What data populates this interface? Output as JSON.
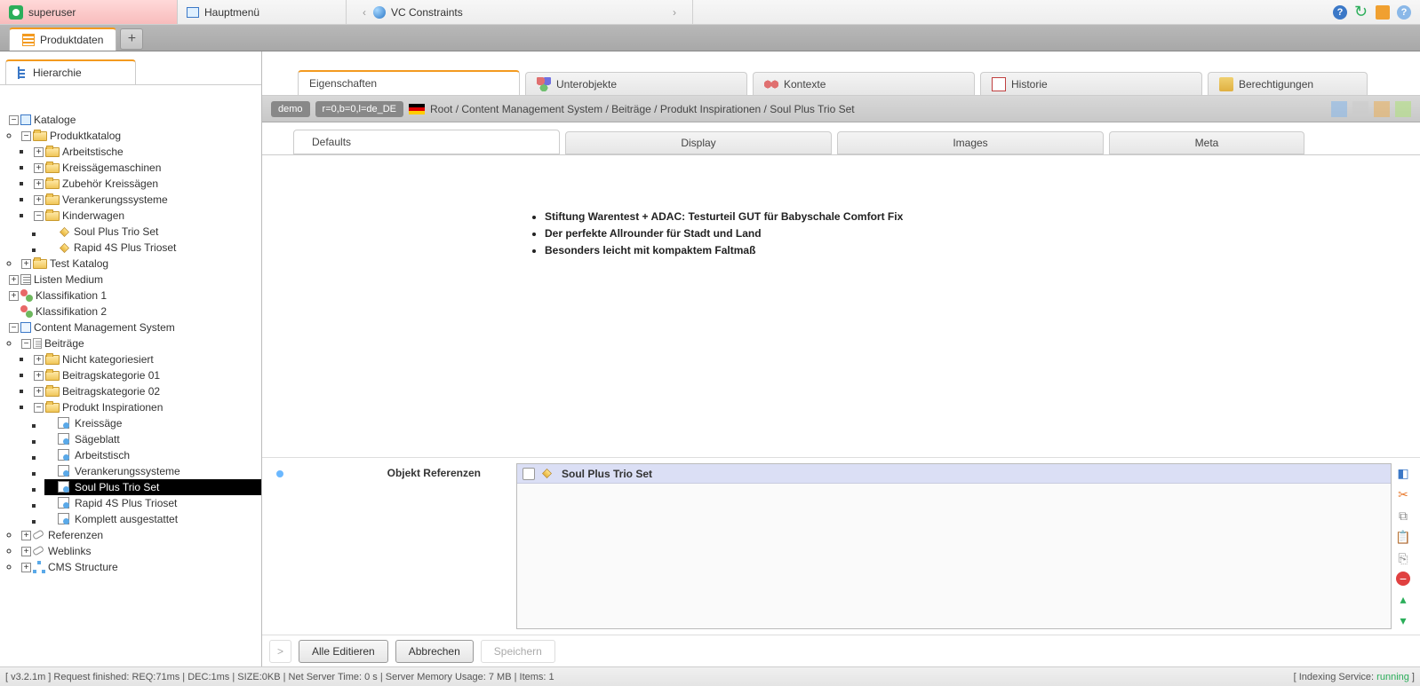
{
  "topbar": {
    "user": "superuser",
    "mainmenu": "Hauptmenü",
    "vc": "VC Constraints"
  },
  "app_tab": "Produktdaten",
  "sidebar_tab": "Hierarchie",
  "tree": {
    "kataloge": "Kataloge",
    "produktkatalog": "Produktkatalog",
    "arbeitstische": "Arbeitstische",
    "kreissaegemaschinen": "Kreissägemaschinen",
    "zubehoer": "Zubehör Kreissägen",
    "verankerung": "Verankerungssysteme",
    "kinderwagen": "Kinderwagen",
    "soul": "Soul Plus Trio Set",
    "rapid": "Rapid 4S Plus Trioset",
    "testkatalog": "Test Katalog",
    "listen": "Listen Medium",
    "klass1": "Klassifikation 1",
    "klass2": "Klassifikation 2",
    "cms": "Content Management System",
    "beitraege": "Beiträge",
    "nichtkat": "Nicht kategoriesiert",
    "bk01": "Beitragskategorie 01",
    "bk02": "Beitragskategorie 02",
    "prodinsp": "Produkt Inspirationen",
    "kreissaege": "Kreissäge",
    "saegeblatt": "Sägeblatt",
    "arbeitstisch": "Arbeitstisch",
    "verankerung2": "Verankerungssysteme",
    "soul2": "Soul Plus Trio Set",
    "rapid2": "Rapid 4S Plus Trioset",
    "komplett": "Komplett ausgestattet",
    "referenzen": "Referenzen",
    "weblinks": "Weblinks",
    "cmsstruct": "CMS Structure"
  },
  "content_tabs": {
    "eigenschaften": "Eigenschaften",
    "unterobjekte": "Unterobjekte",
    "kontexte": "Kontexte",
    "historie": "Historie",
    "berechtigungen": "Berechtigungen"
  },
  "path": {
    "demo": "demo",
    "rev": "r=0,b=0,l=de_DE",
    "crumbs": "Root / Content Management System / Beiträge / Produkt Inspirationen / Soul Plus Trio Set"
  },
  "sub_tabs": {
    "defaults": "Defaults",
    "display": "Display",
    "images": "Images",
    "meta": "Meta"
  },
  "bullets": [
    "Stiftung Warentest + ADAC: Testurteil GUT für Babyschale Comfort Fix",
    "Der perfekte Allrounder für Stadt und Land",
    "Besonders leicht mit kompaktem Faltmaß"
  ],
  "refs": {
    "label": "Objekt Referenzen",
    "item": "Soul Plus Trio Set"
  },
  "buttons": {
    "nav": ">",
    "alle": "Alle Editieren",
    "abbrechen": "Abbrechen",
    "speichern": "Speichern"
  },
  "status": {
    "left": "[ v3.2.1m ] Request finished: REQ:71ms | DEC:1ms | SIZE:0KB | Net Server Time: 0 s | Server Memory Usage: 7 MB | Items: 1",
    "right_pre": "[ Indexing Service: ",
    "right_run": "running",
    "right_post": " ]"
  }
}
